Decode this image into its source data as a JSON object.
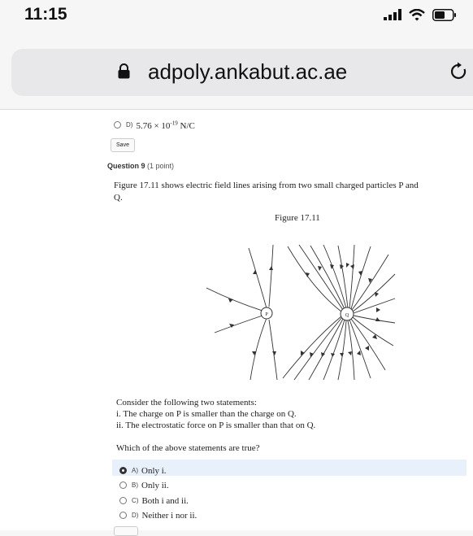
{
  "status": {
    "time": "11:15"
  },
  "browser": {
    "url": "adpoly.ankabut.ac.ae"
  },
  "prev_option": {
    "letter": "D)",
    "text": "5.76 × 10",
    "exp": "-19",
    "unit": " N/C"
  },
  "save_label": "Save",
  "question": {
    "title": "Question 9",
    "points": "(1 point)",
    "line1": "Figure 17.11 shows electric field lines arising from two small charged particles P and",
    "line2": "Q.",
    "figure_caption": "Figure 17.11",
    "label_p": "P",
    "label_q": "Q",
    "stmt_intro": "Consider the following two statements:",
    "stmt1": "i. The charge on P is smaller than the charge on Q.",
    "stmt2": "ii. The electrostatic force on P is smaller than that on Q.",
    "prompt": "Which of the above statements are true?"
  },
  "options": [
    {
      "letter": "A)",
      "text": "Only i.",
      "selected": true
    },
    {
      "letter": "B)",
      "text": "Only ii.",
      "selected": false
    },
    {
      "letter": "C)",
      "text": "Both i and ii.",
      "selected": false
    },
    {
      "letter": "D)",
      "text": "Neither i nor ii.",
      "selected": false
    }
  ]
}
